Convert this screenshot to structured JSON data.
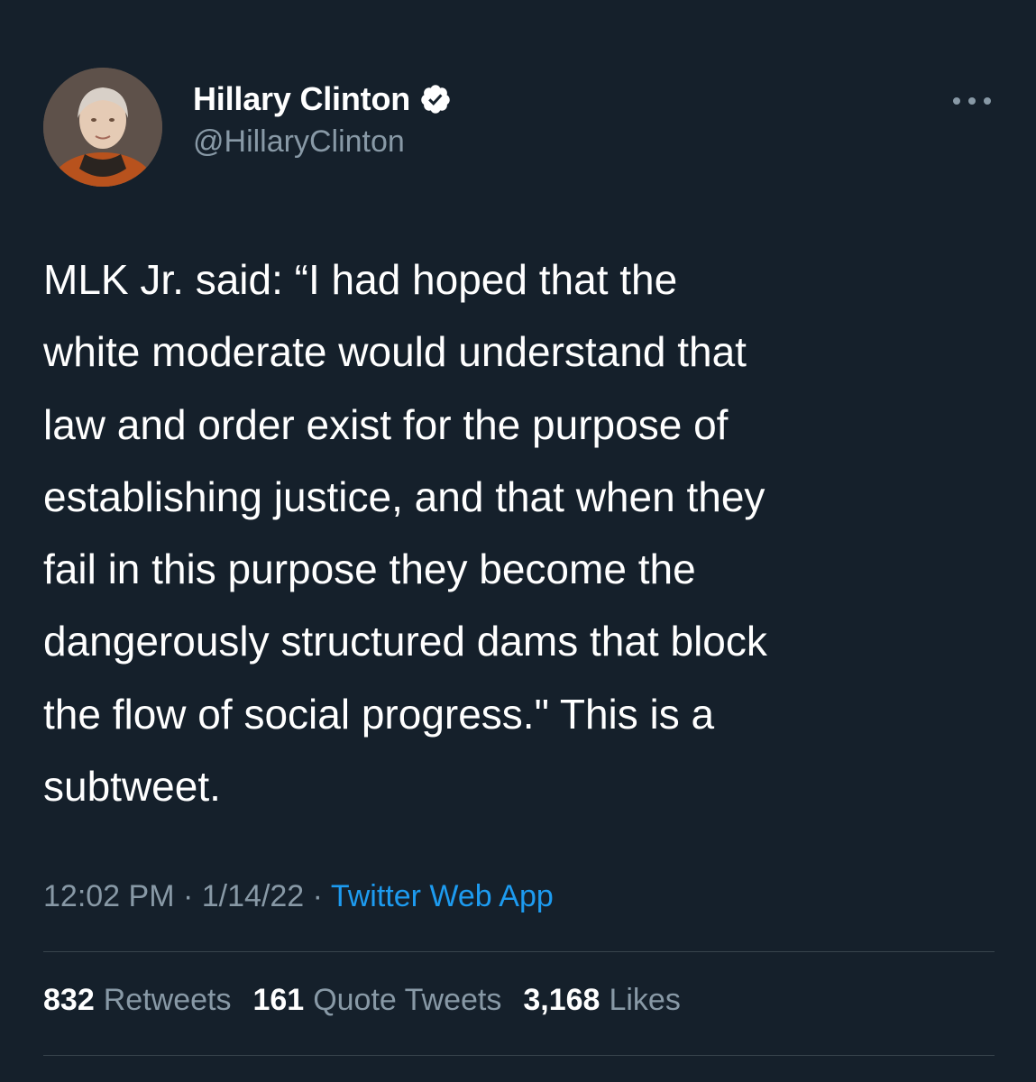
{
  "author": {
    "name": "Hillary Clinton",
    "handle": "@HillaryClinton",
    "verified": true
  },
  "tweet": {
    "text": "MLK Jr. said: “I had hoped that the\nwhite moderate would understand that\nlaw and order exist for the purpose of\nestablishing justice, and that when they\nfail in this purpose they become the\ndangerously structured dams that block\nthe flow of social progress.\" This is a\nsubtweet.",
    "time": "12:02 PM",
    "date": "1/14/22",
    "separator": "·",
    "source": "Twitter Web App"
  },
  "stats": {
    "retweets": {
      "count": "832",
      "label": "Retweets"
    },
    "quotes": {
      "count": "161",
      "label": "Quote Tweets"
    },
    "likes": {
      "count": "3,168",
      "label": "Likes"
    }
  },
  "icons": {
    "verified": "verified-badge-icon",
    "more": "more-options-icon"
  },
  "colors": {
    "background": "#15202b",
    "text": "#ffffff",
    "secondary": "#8899a6",
    "link": "#1d9bf0",
    "divider": "#38444d"
  }
}
